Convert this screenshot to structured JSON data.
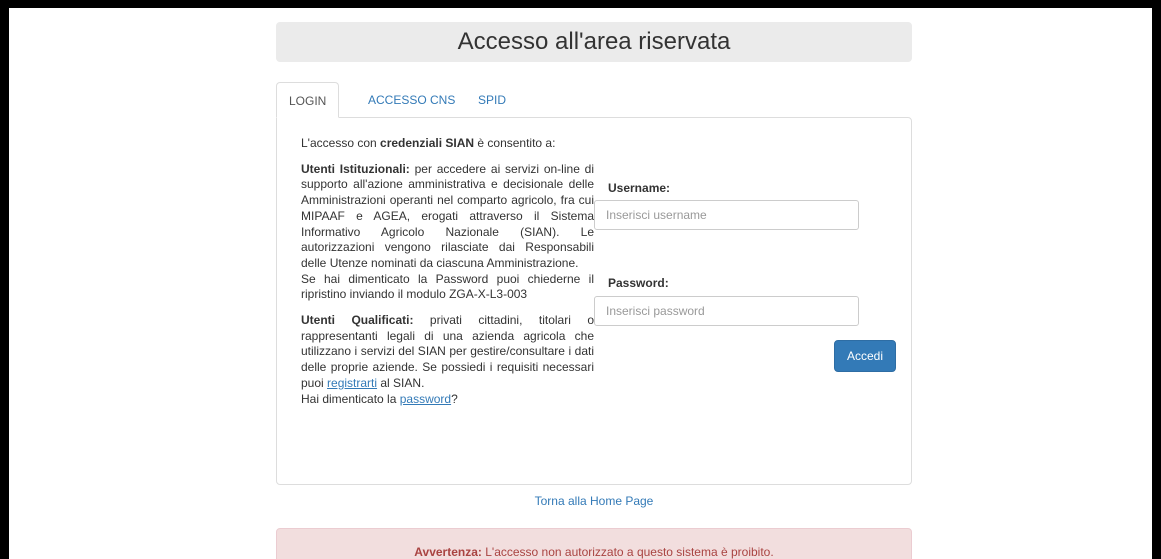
{
  "header": {
    "title": "Accesso all'area riservata"
  },
  "tabs": [
    {
      "label": "LOGIN",
      "active": true
    },
    {
      "label": "ACCESSO CNS",
      "active": false
    },
    {
      "label": "SPID",
      "active": false
    }
  ],
  "intro": {
    "prefix": "L'accesso con ",
    "bold": "credenziali SIAN",
    "suffix": " è consentito a:"
  },
  "istituzionali": {
    "title": "Utenti Istituzionali:",
    "text": " per accedere ai servizi on-line di supporto all'azione amministrativa e decisionale delle Amministrazioni operanti nel comparto agricolo, fra cui MIPAAF e AGEA, erogati attraverso il Sistema Informativo Agricolo Nazionale (SIAN). Le autorizzazioni vengono rilasciate dai Responsabili delle Utenze nominati da ciascuna Amministrazione.",
    "password_note": "Se hai dimenticato la Password puoi chiederne il ripristino inviando il modulo ZGA-X-L3-003"
  },
  "qualificati": {
    "title": "Utenti Qualificati:",
    "text": " privati cittadini, titolari o rappresentanti legali di una azienda agricola che utilizzano i servizi del SIAN per gestire/consultare i dati delle proprie aziende. Se possiedi i requisiti necessari puoi ",
    "register_link": "registrarti",
    "after_link": " al SIAN.",
    "forgot_prefix": "Hai dimenticato la ",
    "forgot_link": "password",
    "forgot_suffix": "?"
  },
  "form": {
    "username_label": "Username:",
    "username_placeholder": "Inserisci username",
    "password_label": "Password:",
    "password_placeholder": "Inserisci password",
    "submit_label": "Accedi"
  },
  "footer": {
    "home_link": "Torna alla Home Page"
  },
  "warning": {
    "bold": "Avvertenza:",
    "text": " L'accesso non autorizzato a questo sistema è proibito."
  }
}
